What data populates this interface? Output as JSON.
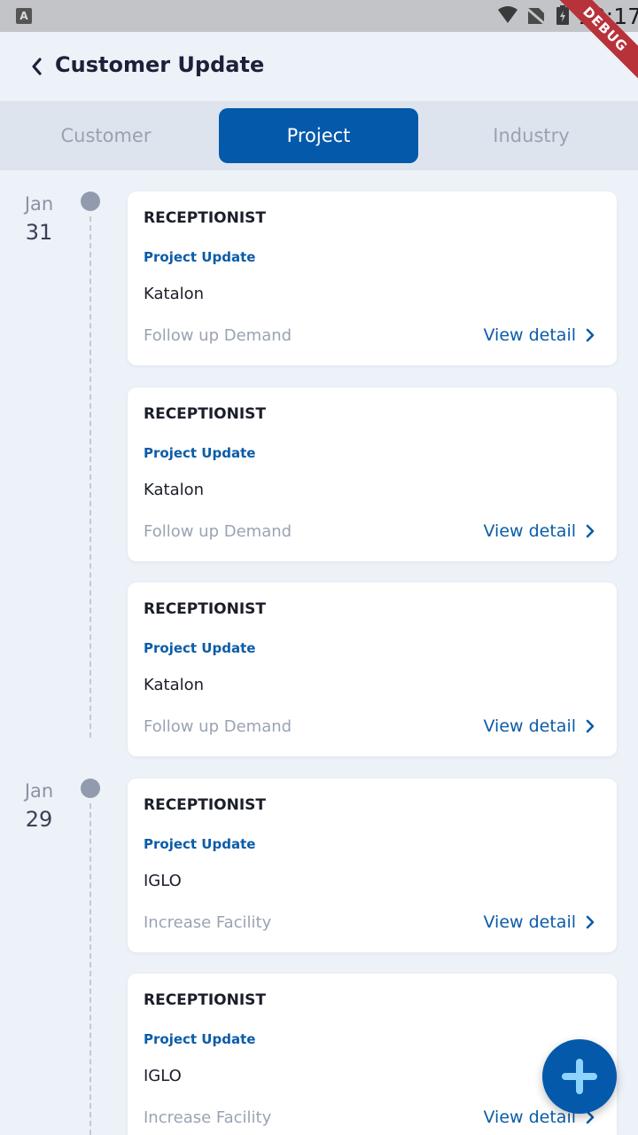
{
  "status_bar": {
    "time": "10:17",
    "debug_label": "DEBUG",
    "app_icon": "A"
  },
  "header": {
    "title": "Customer Update"
  },
  "tabs": [
    {
      "label": "Customer",
      "active": false
    },
    {
      "label": "Project",
      "active": true
    },
    {
      "label": "Industry",
      "active": false
    }
  ],
  "timeline": [
    {
      "month": "Jan",
      "day": "31"
    },
    {
      "month": "Jan",
      "day": "29"
    }
  ],
  "cards": [
    {
      "role": "RECEPTIONIST",
      "type": "Project Update",
      "company": "Katalon",
      "status": "Follow up Demand",
      "link": "View detail"
    },
    {
      "role": "RECEPTIONIST",
      "type": "Project Update",
      "company": "Katalon",
      "status": "Follow up Demand",
      "link": "View detail"
    },
    {
      "role": "RECEPTIONIST",
      "type": "Project Update",
      "company": "Katalon",
      "status": "Follow up Demand",
      "link": "View detail"
    },
    {
      "role": "RECEPTIONIST",
      "type": "Project Update",
      "company": "IGLO",
      "status": "Increase Facility",
      "link": "View detail"
    },
    {
      "role": "RECEPTIONIST",
      "type": "Project Update",
      "company": "IGLO",
      "status": "Increase Facility",
      "link": "View detail"
    }
  ],
  "colors": {
    "primary": "#0459ab",
    "background": "#edf1f8",
    "fab_plus": "#8fd3ff"
  },
  "icons": {
    "back": "chevron-left-icon",
    "view_detail": "chevron-right-icon",
    "fab": "plus-icon"
  }
}
